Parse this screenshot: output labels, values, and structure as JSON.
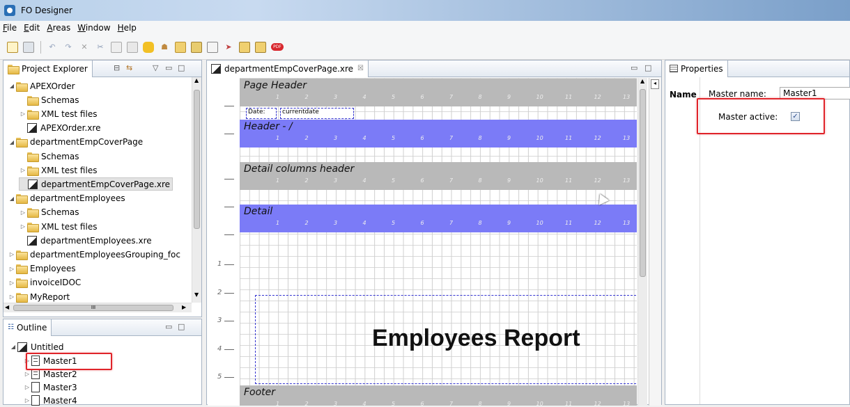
{
  "app": {
    "title": "FO Designer"
  },
  "menu": [
    {
      "pre": "",
      "acc": "F",
      "post": "ile"
    },
    {
      "pre": "",
      "acc": "E",
      "post": "dit"
    },
    {
      "pre": "",
      "acc": "A",
      "post": "reas"
    },
    {
      "pre": "",
      "acc": "W",
      "post": "indow"
    },
    {
      "pre": "",
      "acc": "H",
      "post": "elp"
    }
  ],
  "toolbar": {
    "icons": [
      "new-file-icon",
      "save-icon",
      "undo-icon",
      "redo-icon",
      "delete-icon",
      "cut-icon",
      "copy-icon",
      "paste-icon",
      "database-icon",
      "users-icon",
      "open-icon",
      "open-folder-icon",
      "layout-icon",
      "export-icon",
      "print-icon",
      "print-preview-icon",
      "pdf-icon"
    ],
    "pdf_label": "PDF"
  },
  "project_explorer": {
    "title": "Project Explorer",
    "items": [
      {
        "label": "APEXOrder",
        "kind": "project",
        "indent": 0,
        "arrow": "◢"
      },
      {
        "label": "Schemas",
        "kind": "folder",
        "indent": 1,
        "arrow": ""
      },
      {
        "label": "XML test files",
        "kind": "folder",
        "indent": 1,
        "arrow": "▷"
      },
      {
        "label": "APEXOrder.xre",
        "kind": "file",
        "indent": 1,
        "arrow": ""
      },
      {
        "label": "departmentEmpCoverPage",
        "kind": "project",
        "indent": 0,
        "arrow": "◢"
      },
      {
        "label": "Schemas",
        "kind": "folder",
        "indent": 1,
        "arrow": ""
      },
      {
        "label": "XML test files",
        "kind": "folder",
        "indent": 1,
        "arrow": "▷"
      },
      {
        "label": "departmentEmpCoverPage.xre",
        "kind": "file",
        "indent": 1,
        "arrow": "",
        "selected": true
      },
      {
        "label": "departmentEmployees",
        "kind": "project",
        "indent": 0,
        "arrow": "◢"
      },
      {
        "label": "Schemas",
        "kind": "folder",
        "indent": 1,
        "arrow": "▷"
      },
      {
        "label": "XML test files",
        "kind": "folder",
        "indent": 1,
        "arrow": "▷"
      },
      {
        "label": "departmentEmployees.xre",
        "kind": "file",
        "indent": 1,
        "arrow": ""
      },
      {
        "label": "departmentEmployeesGrouping_foc",
        "kind": "project",
        "indent": 0,
        "arrow": "▷"
      },
      {
        "label": "Employees",
        "kind": "project",
        "indent": 0,
        "arrow": "▷"
      },
      {
        "label": "invoiceIDOC",
        "kind": "project",
        "indent": 0,
        "arrow": "▷"
      },
      {
        "label": "MyReport",
        "kind": "project",
        "indent": 0,
        "arrow": "▷"
      }
    ],
    "hscroll_label": "III"
  },
  "outline": {
    "title": "Outline",
    "root": "Untitled",
    "items": [
      {
        "label": "Master1",
        "active": true
      },
      {
        "label": "Master2",
        "active": true
      },
      {
        "label": "Master3",
        "active": false
      },
      {
        "label": "Master4",
        "active": false
      }
    ]
  },
  "editor": {
    "tab_label": "departmentEmpCoverPage.xre",
    "tab_close": "☒",
    "bands": [
      {
        "name": "page-header-band",
        "label": "Page Header",
        "color": "gray"
      },
      {
        "name": "header-band",
        "label": "Header - /",
        "color": "blue"
      },
      {
        "name": "detail-columns-header-band",
        "label": "Detail columns header",
        "color": "gray"
      },
      {
        "name": "detail-band",
        "label": "Detail",
        "color": "blue"
      },
      {
        "name": "footer-band",
        "label": "Footer",
        "color": "gray"
      }
    ],
    "band_numbers": [
      "1",
      "2",
      "3",
      "4",
      "5",
      "6",
      "7",
      "8",
      "9",
      "10",
      "11",
      "12",
      "13"
    ],
    "ruler_numbers": [
      "1",
      "2",
      "3",
      "4",
      "5"
    ],
    "fields": {
      "date_label": "Date:",
      "date_value": "currentdate"
    },
    "report_title": "Employees Report"
  },
  "properties": {
    "title": "Properties",
    "section_label": "Name",
    "master_name_label": "Master name:",
    "master_name_value": "Master1",
    "master_active_label": "Master active:",
    "master_active_checked": true,
    "check_glyph": "✓"
  },
  "colors": {
    "band_gray": "#b9b9b9",
    "band_blue": "#7b7bf7",
    "highlight": "#e0242a"
  }
}
